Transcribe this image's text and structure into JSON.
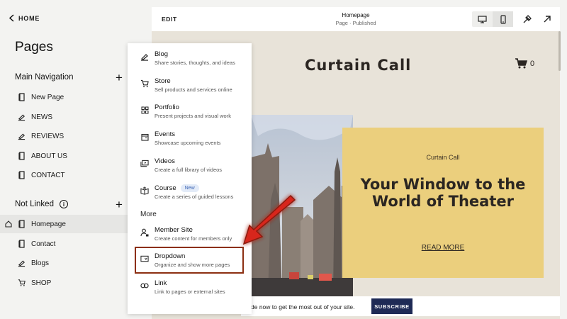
{
  "sidebar": {
    "home_label": "HOME",
    "title": "Pages",
    "main_nav": {
      "heading": "Main Navigation",
      "items": [
        {
          "label": "New Page",
          "icon": "page-icon"
        },
        {
          "label": "NEWS",
          "icon": "blog-icon"
        },
        {
          "label": "REVIEWS",
          "icon": "blog-icon"
        },
        {
          "label": "ABOUT US",
          "icon": "page-icon"
        },
        {
          "label": "CONTACT",
          "icon": "page-icon"
        }
      ]
    },
    "not_linked": {
      "heading": "Not Linked",
      "items": [
        {
          "label": "Homepage",
          "icon": "page-icon",
          "is_home": true,
          "active": true
        },
        {
          "label": "Contact",
          "icon": "page-icon"
        },
        {
          "label": "Blogs",
          "icon": "blog-icon"
        },
        {
          "label": "SHOP",
          "icon": "cart-icon"
        }
      ]
    }
  },
  "topbar": {
    "edit_label": "EDIT",
    "page_title": "Homepage",
    "page_status": "Page · Published"
  },
  "preview": {
    "site_title": "Curtain Call",
    "cart_count": "0",
    "card_small": "Curtain Call",
    "card_heading": "Your Window to the World of Theater",
    "card_link": "READ MORE",
    "colors": {
      "background": "#e8e3d9",
      "card": "#ebcf7d",
      "subscribe": "#1e2a55"
    }
  },
  "banner": {
    "text": "de now to get the most out of your site.",
    "button": "SUBSCRIBE"
  },
  "menu": {
    "items": [
      {
        "title": "Blog",
        "desc": "Share stories, thoughts, and ideas",
        "icon": "blog-icon"
      },
      {
        "title": "Store",
        "desc": "Sell products and services online",
        "icon": "cart-icon"
      },
      {
        "title": "Portfolio",
        "desc": "Present projects and visual work",
        "icon": "grid-icon"
      },
      {
        "title": "Events",
        "desc": "Showcase upcoming events",
        "icon": "calendar-icon"
      },
      {
        "title": "Videos",
        "desc": "Create a full library of videos",
        "icon": "video-icon"
      },
      {
        "title": "Course",
        "desc": "Create a series of guided lessons",
        "icon": "book-icon",
        "badge": "New"
      }
    ],
    "more_label": "More",
    "more_items": [
      {
        "title": "Member Site",
        "desc": "Create content for members only",
        "icon": "member-icon"
      },
      {
        "title": "Dropdown",
        "desc": "Organize and show more pages",
        "icon": "dropdown-icon"
      },
      {
        "title": "Link",
        "desc": "Link to pages or external sites",
        "icon": "link-icon"
      }
    ]
  },
  "annotation": {
    "arrow_color": "#d8281c",
    "highlight_color": "#8c2f12"
  }
}
